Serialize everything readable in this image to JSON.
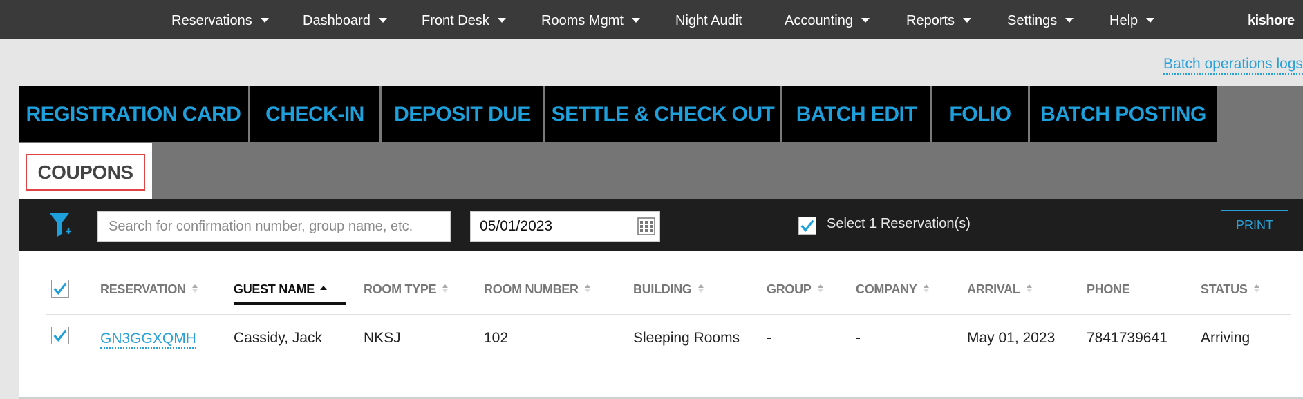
{
  "nav": {
    "items": [
      {
        "label": "Reservations",
        "dropdown": true
      },
      {
        "label": "Dashboard",
        "dropdown": true
      },
      {
        "label": "Front Desk",
        "dropdown": true
      },
      {
        "label": "Rooms Mgmt",
        "dropdown": true
      },
      {
        "label": "Night Audit",
        "dropdown": false
      },
      {
        "label": "Accounting",
        "dropdown": true
      },
      {
        "label": "Reports",
        "dropdown": true
      },
      {
        "label": "Settings",
        "dropdown": true
      },
      {
        "label": "Help",
        "dropdown": true
      }
    ],
    "user": "kishore"
  },
  "batch_link": "Batch operations logs",
  "tabs": [
    "REGISTRATION CARD",
    "CHECK-IN",
    "DEPOSIT DUE",
    "SETTLE & CHECK OUT",
    "BATCH EDIT",
    "FOLIO",
    "BATCH POSTING",
    "COUPONS"
  ],
  "toolbar": {
    "search_placeholder": "Search for confirmation number, group name, etc.",
    "date": "05/01/2023",
    "select_label": "Select 1 Reservation(s)",
    "select_checked": true,
    "print_label": "PRINT"
  },
  "table": {
    "columns": [
      "RESERVATION",
      "GUEST NAME",
      "ROOM TYPE",
      "ROOM NUMBER",
      "BUILDING",
      "GROUP",
      "COMPANY",
      "ARRIVAL",
      "PHONE",
      "STATUS"
    ],
    "sorted_column": "GUEST NAME",
    "rows": [
      {
        "checked": true,
        "reservation": "GN3GGXQMH",
        "guest_name": "Cassidy, Jack",
        "room_type": "NKSJ",
        "room_number": "102",
        "building": "Sleeping Rooms",
        "group": "-",
        "company": "-",
        "arrival": "May 01, 2023",
        "phone": "7841739641",
        "status": "Arriving"
      }
    ]
  },
  "colors": {
    "accent": "#1ea0dc",
    "nav_bg": "#3a3a3a",
    "tab_bg": "#000000",
    "toolbar_bg": "#1e1e1e",
    "highlight_border": "#e04545"
  }
}
